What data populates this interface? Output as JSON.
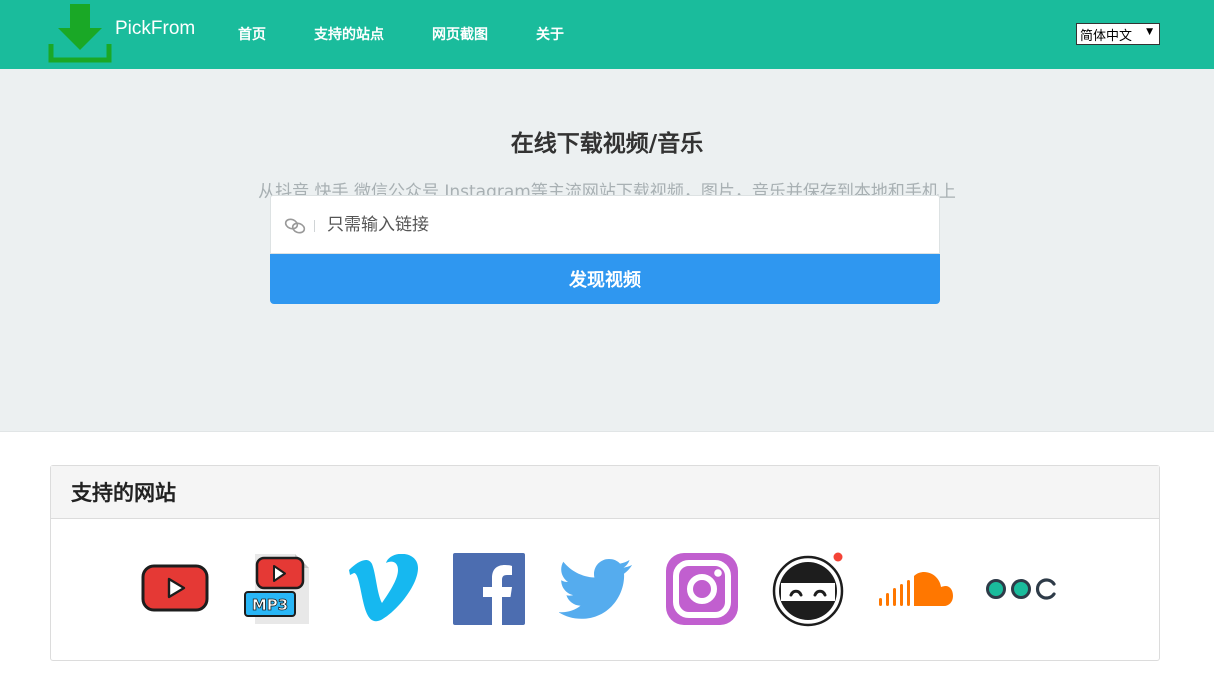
{
  "header": {
    "brand": "PickFrom",
    "nav": [
      "首页",
      "支持的站点",
      "网页截图",
      "关于"
    ],
    "language": "简体中文",
    "color": "#1abc9c"
  },
  "hero": {
    "title": "在线下载视频/音乐",
    "subtitle": "从抖音 快手 微信公众号 Instagram等主流网站下载视频，图片，音乐并保存到本地和手机上",
    "input_placeholder": "只需输入链接",
    "button_label": "发现视频",
    "button_color": "#2f97f0"
  },
  "sites": {
    "title": "支持的网站",
    "icons": [
      "youtube-icon",
      "youtube-mp3-icon",
      "vimeo-icon",
      "facebook-icon",
      "twitter-icon",
      "instagram-icon",
      "ninja-icon",
      "soundcloud-icon",
      "dots-icon"
    ]
  }
}
